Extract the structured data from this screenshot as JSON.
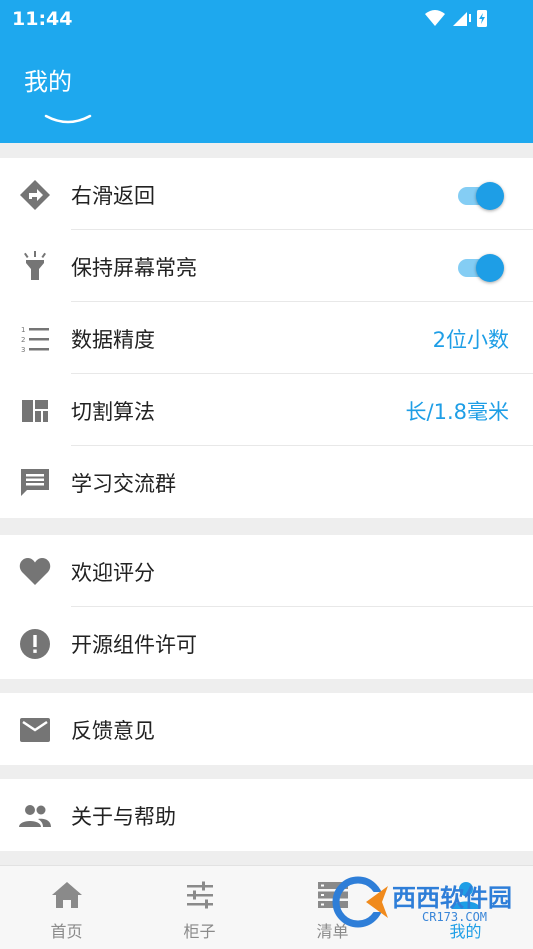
{
  "status_bar": {
    "time": "11:44"
  },
  "header": {
    "title": "我的"
  },
  "settings": {
    "group1": [
      {
        "label": "右滑返回",
        "icon": "swipe-direction-icon",
        "toggle": true
      },
      {
        "label": "保持屏幕常亮",
        "icon": "flashlight-icon",
        "toggle": true
      },
      {
        "label": "数据精度",
        "icon": "numbered-list-icon",
        "value": "2位小数"
      },
      {
        "label": "切割算法",
        "icon": "dashboard-layout-icon",
        "value": "长/1.8毫米"
      },
      {
        "label": "学习交流群",
        "icon": "chat-message-icon"
      }
    ],
    "group2": [
      {
        "label": "欢迎评分",
        "icon": "heart-icon"
      },
      {
        "label": "开源组件许可",
        "icon": "info-alert-icon"
      }
    ],
    "group3": [
      {
        "label": "反馈意见",
        "icon": "mail-icon"
      }
    ],
    "group4": [
      {
        "label": "关于与帮助",
        "icon": "people-icon"
      }
    ]
  },
  "bottom_nav": [
    {
      "label": "首页",
      "icon": "home-icon"
    },
    {
      "label": "柜子",
      "icon": "sliders-icon"
    },
    {
      "label": "清单",
      "icon": "list-storage-icon"
    },
    {
      "label": "我的",
      "icon": "person-icon",
      "active": true
    }
  ],
  "watermark": {
    "text": "西西软件园",
    "sub": "CR173.COM"
  },
  "colors": {
    "accent": "#1ea8ee",
    "value_text": "#1e9ee6",
    "icon_gray": "#757575"
  }
}
